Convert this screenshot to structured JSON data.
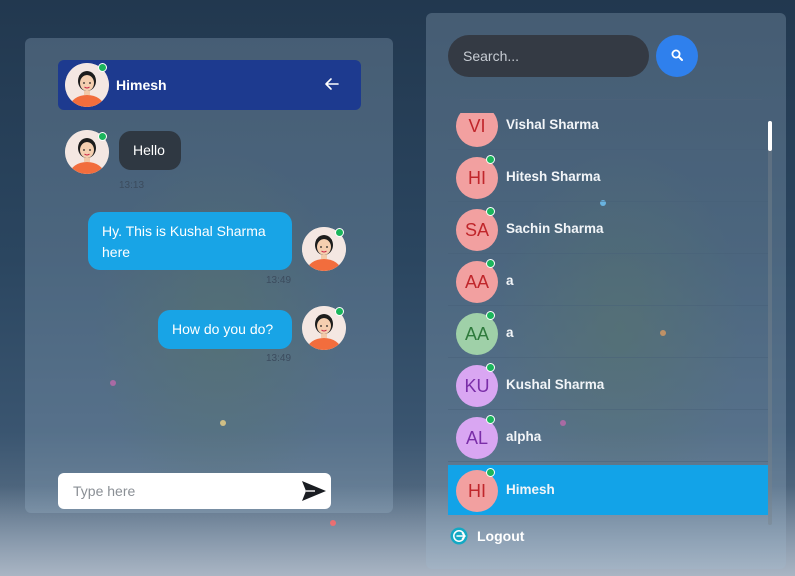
{
  "colors": {
    "header_bg": "#1d3a8f",
    "incoming_bubble": "#2f3842",
    "outgoing_bubble": "#18a4e6",
    "active_user_bg": "#12a3e8",
    "search_button": "#2f80ed",
    "online": "#1bb55c"
  },
  "chat": {
    "header": {
      "name": "Himesh",
      "back_icon": "arrow-left-icon"
    },
    "messages": [
      {
        "direction": "incoming",
        "text": "Hello",
        "time": "13:13"
      },
      {
        "direction": "outgoing",
        "text": "Hy. This is Kushal Sharma here",
        "time": "13:49"
      },
      {
        "direction": "outgoing",
        "text": "How do you do?",
        "time": "13:49"
      }
    ],
    "composer": {
      "placeholder": "Type here",
      "value": "",
      "send_icon": "send-icon"
    }
  },
  "sidebar": {
    "search": {
      "placeholder": "Search...",
      "value": "",
      "icon": "search-icon"
    },
    "users": [
      {
        "initials": "VI",
        "name": "Vishal Sharma",
        "avatar_bg": "#f2a0a0",
        "initials_color": "#c0262b",
        "online": false,
        "active": false
      },
      {
        "initials": "HI",
        "name": "Hitesh Sharma",
        "avatar_bg": "#f2a0a0",
        "initials_color": "#c0262b",
        "online": true,
        "active": false
      },
      {
        "initials": "SA",
        "name": "Sachin Sharma",
        "avatar_bg": "#f2a0a0",
        "initials_color": "#c0262b",
        "online": true,
        "active": false
      },
      {
        "initials": "AA",
        "name": "a",
        "avatar_bg": "#f2a0a0",
        "initials_color": "#c0262b",
        "online": true,
        "active": false
      },
      {
        "initials": "AA",
        "name": "a",
        "avatar_bg": "#9fd0a8",
        "initials_color": "#2e7a3c",
        "online": true,
        "active": false
      },
      {
        "initials": "KU",
        "name": "Kushal Sharma",
        "avatar_bg": "#d9a6f2",
        "initials_color": "#7a2ea8",
        "online": true,
        "active": false
      },
      {
        "initials": "AL",
        "name": "alpha",
        "avatar_bg": "#d9a6f2",
        "initials_color": "#7a2ea8",
        "online": true,
        "active": false
      },
      {
        "initials": "HI",
        "name": "Himesh",
        "avatar_bg": "#f2a0a0",
        "initials_color": "#c0262b",
        "online": true,
        "active": true
      }
    ],
    "logout": {
      "label": "Logout",
      "icon": "logout-icon"
    }
  }
}
